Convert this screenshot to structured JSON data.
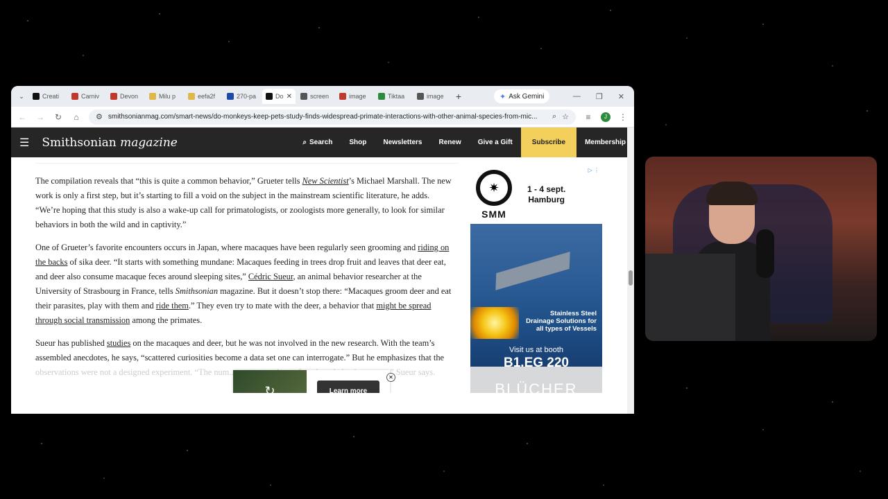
{
  "browser": {
    "tabs": [
      {
        "title": "Creati",
        "favicon_color": "#111111",
        "active": false
      },
      {
        "title": "Carniv",
        "favicon_color": "#c0392b",
        "active": false
      },
      {
        "title": "Devon",
        "favicon_color": "#c0392b",
        "active": false
      },
      {
        "title": "Milu p",
        "favicon_color": "#e0b84a",
        "active": false
      },
      {
        "title": "eefa2f",
        "favicon_color": "#e0b84a",
        "active": false
      },
      {
        "title": "270-pa",
        "favicon_color": "#1f4aa8",
        "active": false
      },
      {
        "title": "Do",
        "favicon_color": "#111111",
        "active": true
      },
      {
        "title": "screen",
        "favicon_color": "#555555",
        "active": false
      },
      {
        "title": "image",
        "favicon_color": "#c0392b",
        "active": false
      },
      {
        "title": "Tiktaa",
        "favicon_color": "#2e8b3e",
        "active": false
      },
      {
        "title": "image",
        "favicon_color": "#555555",
        "active": false
      }
    ],
    "new_tab": "+",
    "gemini_label": "Ask Gemini",
    "url": "smithsonianmag.com/smart-news/do-monkeys-keep-pets-study-finds-widespread-primate-interactions-with-other-animal-species-from-mic...",
    "profile_initial": "J"
  },
  "site": {
    "logo_main": "Smithsonian",
    "logo_sub": "magazine",
    "nav": {
      "search": "Search",
      "shop": "Shop",
      "newsletters": "Newsletters",
      "renew": "Renew",
      "give_gift": "Give a Gift",
      "subscribe": "Subscribe",
      "membership": "Membership"
    }
  },
  "article": {
    "p1_a": "The compilation reveals that “this is quite a common behavior,” Grueter tells ",
    "p1_link": "New Scientist",
    "p1_b": "’s Michael Marshall. The new work is only a first step, but it’s starting to fill a void on the subject in the mainstream scientific literature, he adds. “We’re hoping that this study is also a wake-up call for primatologists, or zoologists more generally, to look for similar behaviors in both the wild and in captivity.”",
    "p2_a": "One of Grueter’s favorite encounters occurs in Japan, where macaques have been regularly seen grooming and ",
    "p2_link1": "riding on the backs",
    "p2_b": " of sika deer. “It starts with something mundane: Macaques feeding in trees drop fruit and leaves that deer eat, and deer also consume macaque feces around sleeping sites,” ",
    "p2_link2": "Cédric Sueur",
    "p2_c": ", an animal behavior researcher at the University of Strasbourg in France, tells ",
    "p2_em": "Smithsonian",
    "p2_d": " magazine. But it doesn’t stop there: “Macaques groom deer and eat their parasites, play with them and ",
    "p2_link3": "ride them",
    "p2_e": ".” They even try to mate with the deer, a behavior that ",
    "p2_link4": "might be spread through social transmission",
    "p2_f": " among the primates.",
    "p3_a": "Sueur has published ",
    "p3_link": "studies",
    "p3_b": " on the macaques and deer, but he was not involved in the new research. With the team’s assembled anecdotes, he says, “scattered curiosities become a data set one can interrogate.” But he emphasizes that the ",
    "p3_fade": "observations were not a designed experiment. “The num... ...seen, not how often these behaviors occur,” Sueur says."
  },
  "ad": {
    "brand": "SMM",
    "dates": "1 - 4 sept.",
    "city": "Hamburg",
    "slogan_1": "Stainless Steel",
    "slogan_2": "Drainage Solutions for",
    "slogan_3": "all types of Vessels",
    "visit": "Visit us at booth",
    "booth": "B1.EG 220",
    "maker": "BLÜCHER"
  },
  "video_ad": {
    "cta": "Learn more"
  }
}
